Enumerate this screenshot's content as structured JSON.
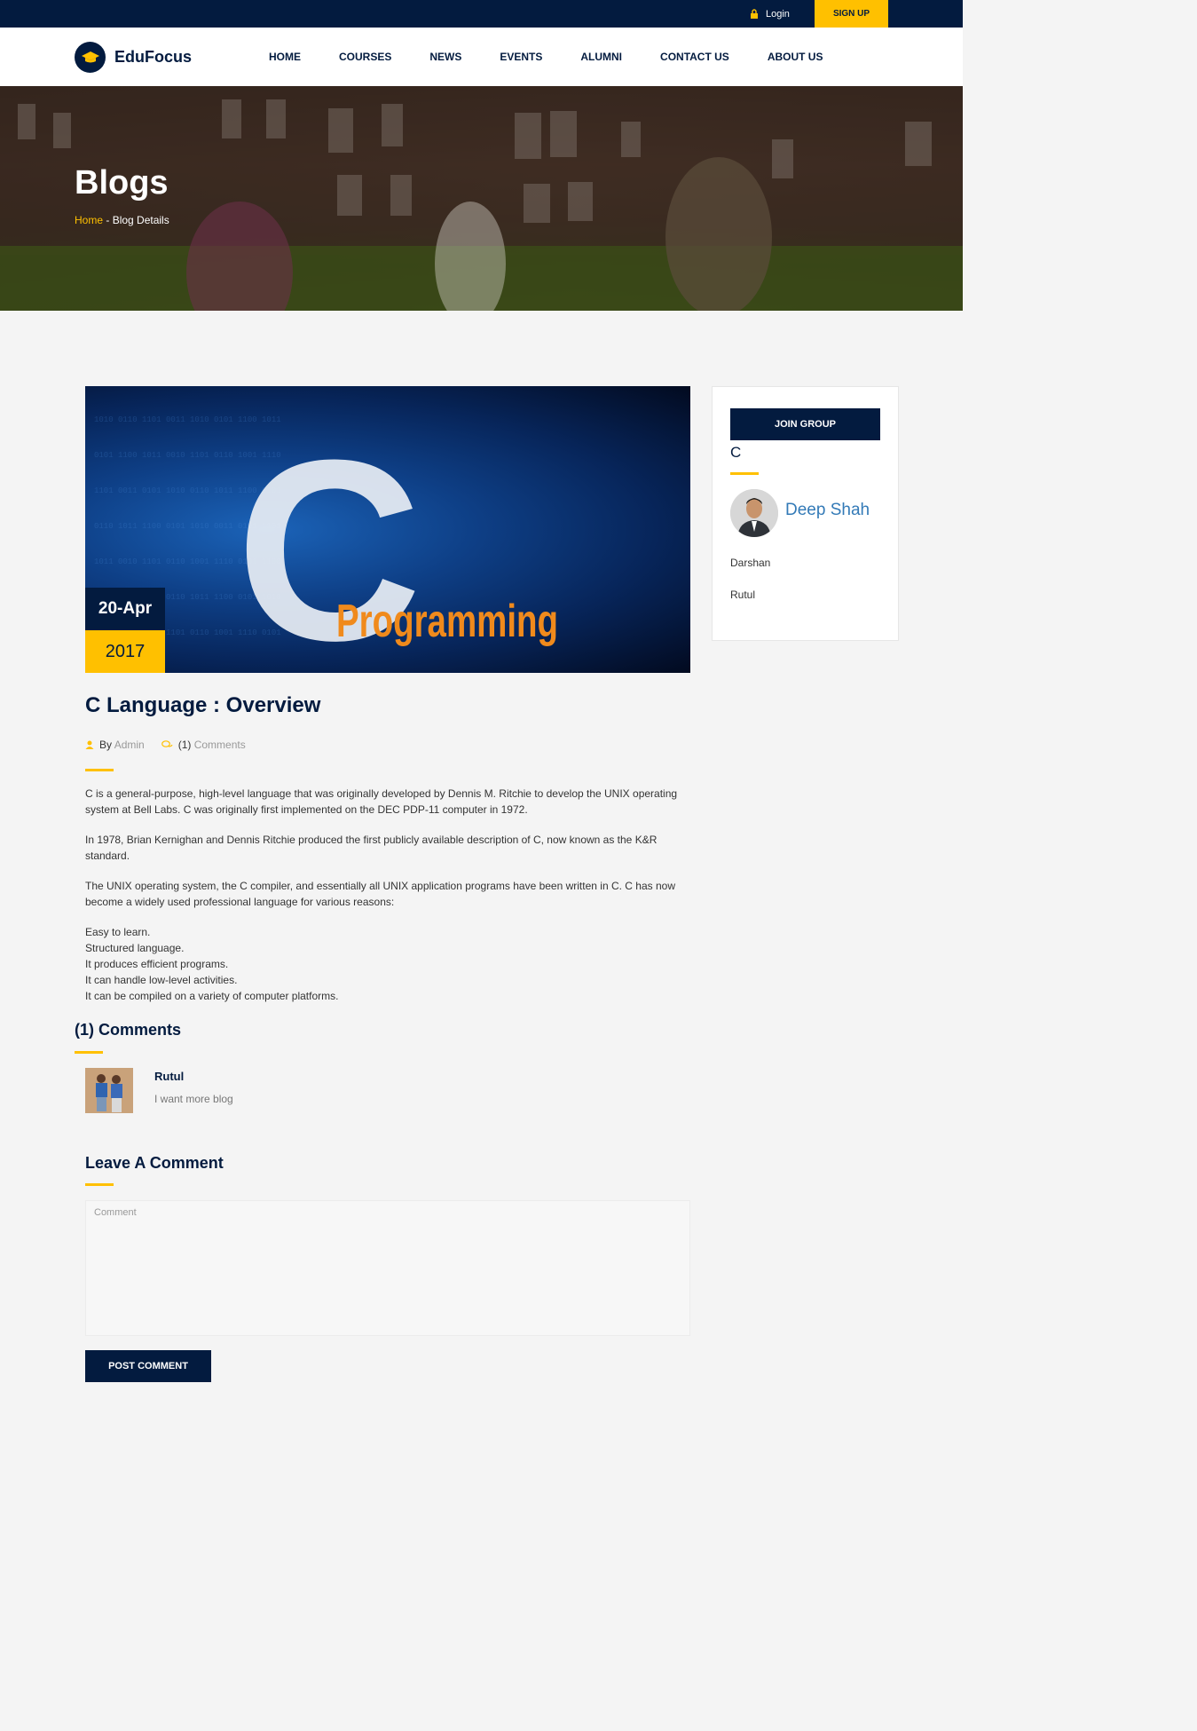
{
  "topbar": {
    "login_label": "Login",
    "signup_label": "SIGN UP",
    "accent_color": "#ffc000",
    "navy_color": "#031b3f"
  },
  "header": {
    "logo_text": "EduFocus",
    "logo_icon": "graduation-cap-icon",
    "nav": [
      {
        "label": "HOME"
      },
      {
        "label": "COURSES"
      },
      {
        "label": "NEWS"
      },
      {
        "label": "EVENTS"
      },
      {
        "label": "ALUMNI"
      },
      {
        "label": "CONTACT US"
      },
      {
        "label": "ABOUT US"
      }
    ]
  },
  "hero": {
    "title": "Blogs",
    "breadcrumb_home": "Home",
    "breadcrumb_separator": " - ",
    "breadcrumb_current": "Blog Details"
  },
  "post": {
    "image_text_big": "C",
    "image_text_word": "Programming",
    "date_day": "20-Apr",
    "date_year": "2017",
    "title": "C Language : Overview",
    "by_label": "By",
    "author": "Admin",
    "comment_count": "(1)",
    "comments_label": "Comments",
    "paragraphs": [
      "C is a general-purpose, high-level language that was originally developed by Dennis M. Ritchie to develop the UNIX operating system at Bell Labs. C was originally first implemented on the DEC PDP-11 computer in 1972.",
      "In 1978, Brian Kernighan and Dennis Ritchie produced the first publicly available description of C, now known as the K&R standard.",
      "The UNIX operating system, the C compiler, and essentially all UNIX application programs have been written in C. C has now become a widely used professional language for various reasons:"
    ],
    "list": [
      "Easy to learn.",
      "Structured language.",
      "It produces efficient programs.",
      "It can handle low-level activities.",
      "It can be compiled on a variety of computer platforms."
    ]
  },
  "comments": {
    "title": "(1) Comments",
    "items": [
      {
        "name": "Rutul",
        "text": "I want more blog"
      }
    ]
  },
  "leave_comment": {
    "title": "Leave A Comment",
    "placeholder": "Comment",
    "submit_label": "POST COMMENT"
  },
  "sidebar": {
    "join_label": "JOIN GROUP",
    "group_name": "C",
    "featured_member": "Deep Shah",
    "members": [
      "Darshan",
      "Rutul"
    ]
  }
}
